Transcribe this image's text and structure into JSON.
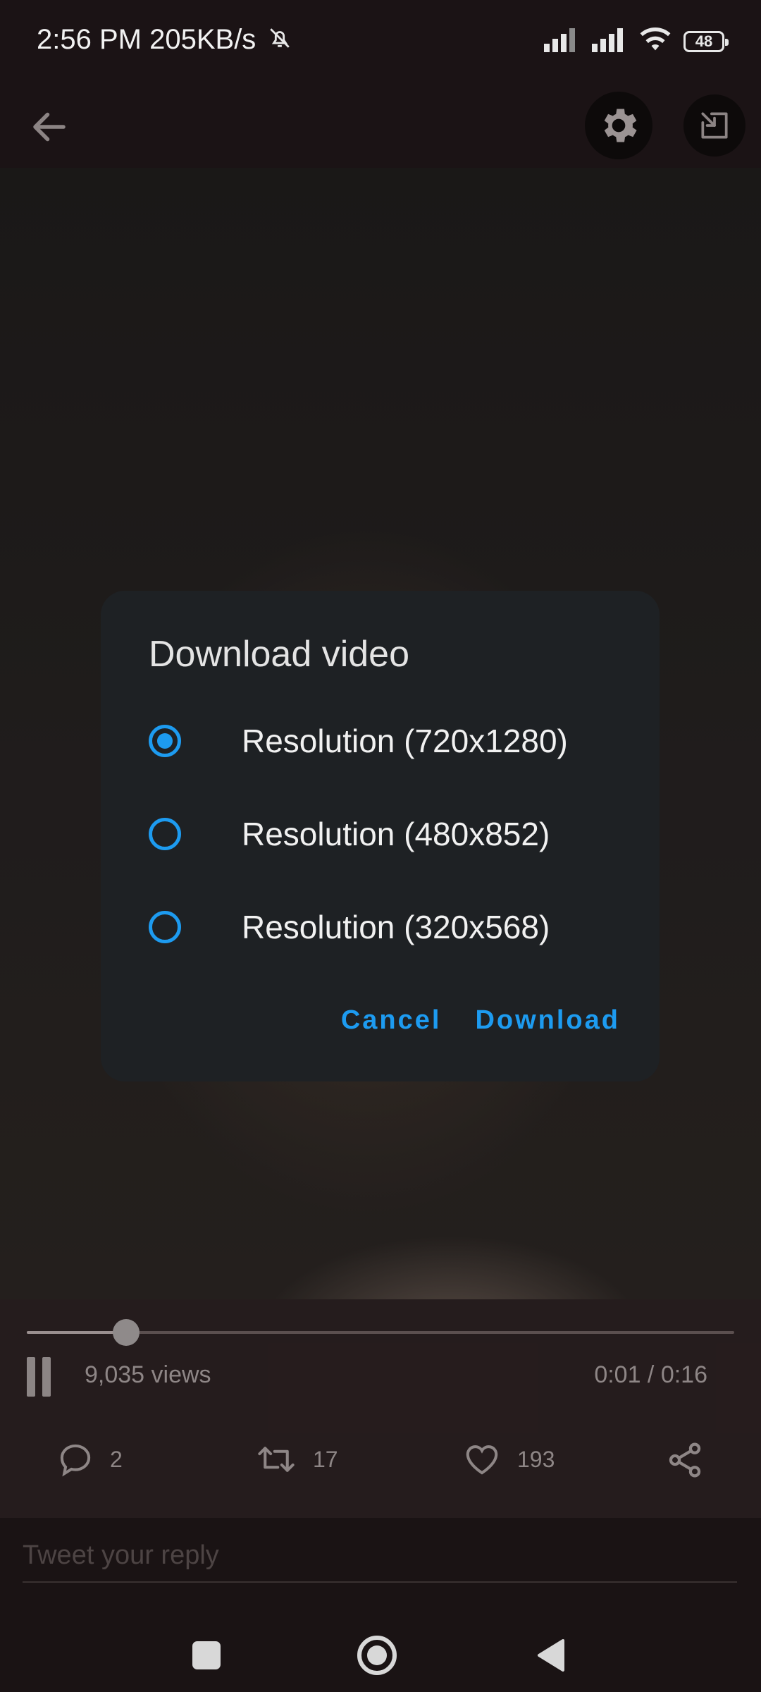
{
  "status_bar": {
    "time": "2:56 PM",
    "speed": "205KB/s",
    "battery": "48",
    "icons": [
      "mute-icon",
      "signal-icon",
      "signal-icon",
      "wifi-icon",
      "battery-icon"
    ]
  },
  "toolbar": {
    "icons": [
      "back-arrow-icon",
      "gear-icon",
      "picture-in-picture-icon"
    ]
  },
  "player": {
    "progress": 0.14,
    "views": "9,035 views",
    "time": "0:01 / 0:16"
  },
  "actions": {
    "replies": "2",
    "retweets": "17",
    "likes": "193",
    "icons": [
      "reply-icon",
      "retweet-icon",
      "heart-icon",
      "share-icon"
    ]
  },
  "reply": {
    "placeholder": "Tweet your reply"
  },
  "dialog": {
    "title": "Download video",
    "options": [
      {
        "label": "Resolution (720x1280)",
        "selected": true
      },
      {
        "label": "Resolution (480x852)",
        "selected": false
      },
      {
        "label": "Resolution (320x568)",
        "selected": false
      }
    ],
    "cancel": "Cancel",
    "confirm": "Download"
  },
  "colors": {
    "accent": "#1d9bf0",
    "dialog_bg": "#1e2124",
    "background": "#1a1314"
  },
  "navbar": {
    "icons": [
      "recents-square-icon",
      "home-circle-icon",
      "back-triangle-icon"
    ]
  }
}
